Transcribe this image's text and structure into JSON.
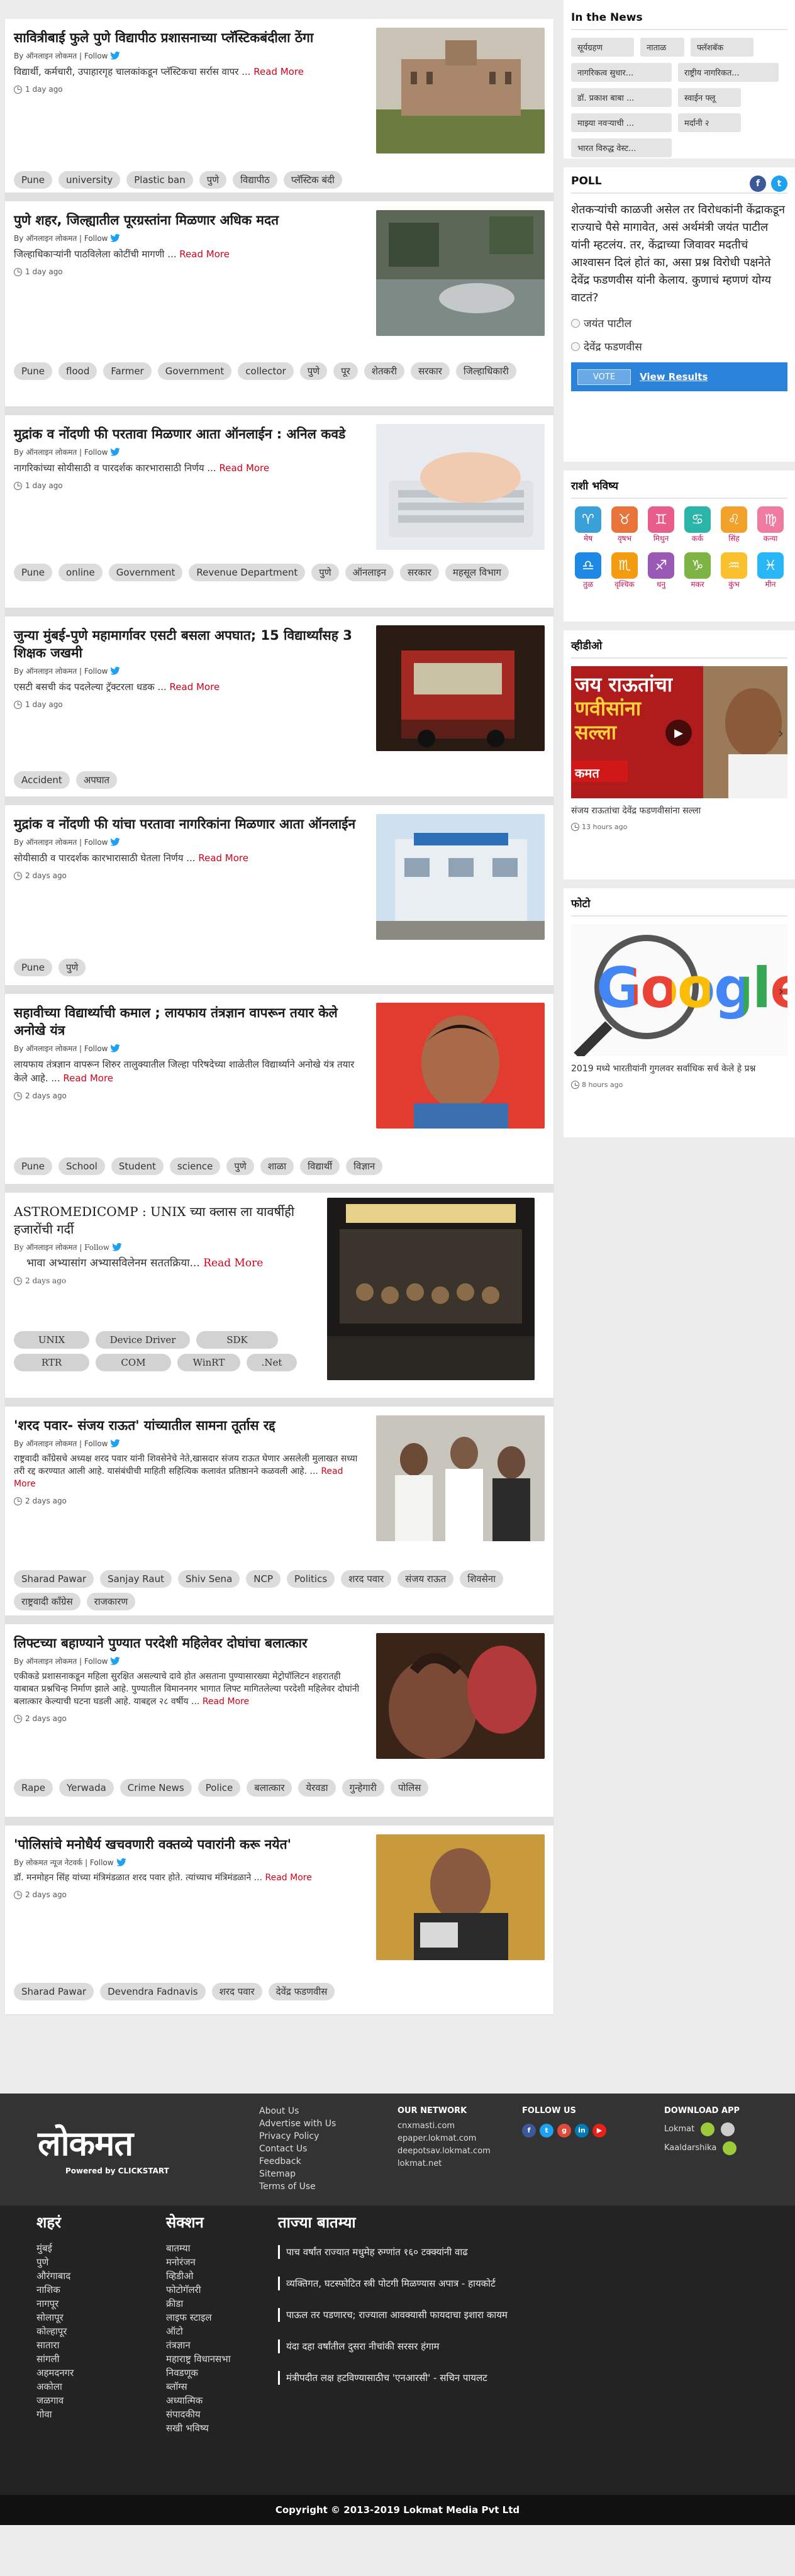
{
  "articles": [
    {
      "title": "सावित्रीबाई फुले पुणे विद्यापीठ प्रशासनाच्या प्लॅस्टिकबंदीला ठेंगा",
      "byline": "By ऑनलाइन लोकमत | Follow",
      "summary": "विद्यार्थी, कर्मचारी, उपाहारगृह चालकांकडून प्लॅस्टिकचा सर्रास वापर ...",
      "readmore": "Read More",
      "time": "1 day ago",
      "tags": [
        "Pune",
        "university",
        "Plastic ban",
        "पुणे",
        "विद्यापीठ",
        "प्लॅस्टिक बंदी"
      ]
    },
    {
      "title": "पुणे शहर, जिल्ह्यातील पूरग्रस्तांना मिळणार अधिक मदत",
      "byline": "By ऑनलाइन लोकमत | Follow",
      "summary": "जिल्हाधिकाऱ्यांनी पाठविलेला कोटींची मागणी ...",
      "readmore": "Read More",
      "time": "1 day ago",
      "tags": [
        "Pune",
        "flood",
        "Farmer",
        "Government",
        "collector",
        "पुणे",
        "पूर",
        "शेतकरी",
        "सरकार",
        "जिल्हाधिकारी"
      ]
    },
    {
      "title": "मुद्रांक व नोंदणी फी परतावा मिळणार आता ऑनलाईन : अनिल कवडे",
      "byline": "By ऑनलाइन लोकमत | Follow",
      "summary": "नागरिकांच्या सोयीसाठी व पारदर्शक कारभारासाठी निर्णय ...",
      "readmore": "Read More",
      "time": "1 day ago",
      "tags": [
        "Pune",
        "online",
        "Government",
        "Revenue Department",
        "पुणे",
        "ऑनलाइन",
        "सरकार",
        "महसूल विभाग"
      ]
    },
    {
      "title": "जुन्या मुंबई-पुणे महामार्गावर एसटी बसला अपघात; 15 विद्यार्थ्यांसह 3 शिक्षक जखमी",
      "byline": "By ऑनलाइन लोकमत | Follow",
      "summary": "एसटी बसची कंद पदलेल्या ट्रॅक्टरला धडक ...",
      "readmore": "Read More",
      "time": "1 day ago",
      "tags": [
        "Accident",
        "अपघात"
      ]
    },
    {
      "title": "मुद्रांक व नोंदणी फी यांचा परतावा नागरिकांना मिळणार आता ऑनलाईन",
      "byline": "By ऑनलाइन लोकमत | Follow",
      "summary": "सोयीसाठी व पारदर्शक कारभारासाठी घेतला निर्णय ...",
      "readmore": "Read More",
      "time": "2 days ago",
      "tags": [
        "Pune",
        "पुणे"
      ]
    },
    {
      "title": "सहावीच्या विद्यार्थ्याची कमाल ; लायफाय तंत्रज्ञान वापरून तयार केले अनोखे यंत्र",
      "byline": "By ऑनलाइन लोकमत | Follow",
      "summary": "लायफाय तंत्रज्ञान वापरून शिरुर तालुक्यातील जिल्हा परिषदेच्या शाळेतील विद्यार्थ्याने अनोखे यंत्र तयार केले आहे. ...",
      "readmore": "Read More",
      "time": "2 days ago",
      "tags": [
        "Pune",
        "School",
        "Student",
        "science",
        "पुणे",
        "शाळा",
        "विद्यार्थी",
        "विज्ञान"
      ]
    },
    {
      "title": "ASTROMEDICOMP : UNIX च्या क्लास ला यावर्षीही हजारोंची गर्दी",
      "byline": "By ऑनलाइन लोकमत | Follow",
      "summary": "भावा अभ्यासांग अभ्यासविलेनम सततक्रिया... ",
      "readmore": "Read More",
      "time": "2 days ago",
      "tags": [
        "UNIX",
        "Device Driver",
        "SDK",
        "RTR",
        "COM",
        "WinRT",
        ".Net"
      ]
    },
    {
      "title": "'शरद पवार- संजय राऊत' यांच्यातील सामना तूर्तास रद्द",
      "byline": "By ऑनलाइन लोकमत | Follow",
      "summary": "राष्ट्रवादी काँग्रेसचे अध्यक्ष शरद पवार यांनी शिवसेनेचे नेते,खासदार संजय राऊत घेणार असलेली मुलाखत सध्या तरी रद्द करण्यात आली आहे. यासंबंधीची माहिती सहित्यिक कलावंत प्रतिष्ठानने कळवली आहे. ...",
      "readmore": "Read More",
      "time": "2 days ago",
      "tags": [
        "Sharad Pawar",
        "Sanjay Raut",
        "Shiv Sena",
        "NCP",
        "Politics",
        "शरद पवार",
        "संजय राऊत",
        "शिवसेना",
        "राष्ट्रवादी काँग्रेस",
        "राजकारण"
      ]
    },
    {
      "title": "लिफ्टच्या बहाण्याने पुण्यात परदेशी महिलेवर दोघांचा बलात्कार",
      "byline": "By ऑनलाइन लोकमत | Follow",
      "summary": "एकीकडे प्रशासनाकडून महिला सुरक्षित असल्याचे दावे होत असताना पुण्यासारख्या मेट्रोपॉलिटन शहरातही याबाबत प्रश्नचिन्ह निर्माण झाले आहे. पुण्यातील विमाननगर भागात लिफ्ट मागितलेल्या परदेशी महिलेवर दोघांनी बलात्कार केल्याची घटना घडली आहे. याबद्दल २८ वर्षीय ...",
      "readmore": "Read More",
      "time": "2 days ago",
      "tags": [
        "Rape",
        "Yerwada",
        "Crime News",
        "Police",
        "बलात्कार",
        "येरवडा",
        "गुन्हेगारी",
        "पोलिस"
      ]
    },
    {
      "title": "'पोलिसांचे मनोधैर्य खचवणारी वक्तव्ये पवारांनी करू नयेत'",
      "byline": "By लोकमत न्यूज नेटवर्क | Follow",
      "summary": "डॉ. मनमोहन सिंह यांच्या मंत्रिमंडळात शरद पवार होते. त्यांच्याच मंत्रिमंडळाने ...",
      "readmore": "Read More",
      "time": "2 days ago",
      "tags": [
        "Sharad Pawar",
        "Devendra Fadnavis",
        "शरद पवार",
        "देवेंद्र फडणवीस"
      ]
    }
  ],
  "sidebar": {
    "news": {
      "title": "In the News",
      "tags": [
        "सूर्यग्रहण",
        "नाताळ",
        "फ्लॅशबॅक",
        "नागरिकत्व सुधार...",
        "राष्ट्रीय नागरिकत...",
        "डॉ. प्रकाश बाबा ...",
        "स्वाईन फ्लू",
        "माझ्या नवऱ्याची ...",
        "मर्दानी २",
        "भारत विरुद्ध वेस्ट..."
      ]
    },
    "poll": {
      "title": "POLL",
      "question": "शेतकऱ्यांची काळजी असेल तर विरोधकांनी केंद्राकडून राज्याचे पैसे मागावेत, असं अर्थमंत्री जयंत पाटील यांनी म्हटलंय. तर, केंद्राच्या जिवावर मदतीचं आश्वासन दिलं होतं का, असा प्रश्न विरोधी पक्षनेते देवेंद्र फडणवीस यांनी केलाय. कुणाचं म्हणणं योग्य वाटतं?",
      "options": [
        "जयंत पाटील",
        "देवेंद्र फडणवीस"
      ],
      "vote": "VOTE",
      "view_results": "View Results"
    },
    "rashi": {
      "title": "राशी भविष्य",
      "signs": [
        "मेष",
        "वृषभ",
        "मिथुन",
        "कर्क",
        "सिंह",
        "कन्या",
        "तुळ",
        "वृश्चिक",
        "धनु",
        "मकर",
        "कुंभ",
        "मीन"
      ],
      "glyphs": [
        "♈",
        "♉",
        "♊",
        "♋",
        "♌",
        "♍",
        "♎",
        "♏",
        "♐",
        "♑",
        "♒",
        "♓"
      ],
      "colors": [
        "#3aa0d8",
        "#e8743b",
        "#e85d8a",
        "#2bb5a8",
        "#f2a12b",
        "#ef7b9e",
        "#1e88e5",
        "#f39c12",
        "#9b59b6",
        "#7cb342",
        "#fbc02d",
        "#29b6f6"
      ]
    },
    "video": {
      "title": "व्हीडीओ",
      "overlay1": "जय राऊतांचा",
      "overlay2": "णवीसांना",
      "overlay3": "सल्ला",
      "tag": "कमत",
      "caption": "संजय राऊतांचा देवेंद्र फडणवीसांना सल्ला",
      "time": "13 hours ago"
    },
    "photo": {
      "title": "फोटो",
      "logo": "Google",
      "caption": "2019 मध्ये भारतीयांनी गुगलवर सर्वाधिक सर्च केले हे प्रश्न",
      "time": "8 hours ago"
    }
  },
  "footer": {
    "logo": "लोकमत",
    "powered": "Powered by CLICKSTART",
    "links": [
      "About Us",
      "Advertise with Us",
      "Privacy Policy",
      "Contact Us",
      "Feedback",
      "Sitemap",
      "Terms of Use"
    ],
    "network_title": "OUR NETWORK",
    "network": [
      "cnxmasti.com",
      "epaper.lokmat.com",
      "deepotsav.lokmat.com",
      "lokmat.net"
    ],
    "follow_title": "FOLLOW US",
    "download_title": "DOWNLOAD APP",
    "apps": [
      "Lokmat",
      "Kaaldarshika"
    ],
    "cities_title": "शहरं",
    "cities": [
      "मुंबई",
      "पुणे",
      "औरंगाबाद",
      "नाशिक",
      "नागपूर",
      "सोलापूर",
      "कोल्हापूर",
      "सातारा",
      "सांगली",
      "अहमदनगर",
      "अकोला",
      "जळगाव",
      "गोवा"
    ],
    "sections_title": "सेक्शन",
    "sections": [
      "बातम्या",
      "मनोरंजन",
      "व्हिडीओ",
      "फोटोगॅलरी",
      "क्रीडा",
      "लाइफ स्टाइल",
      "ऑटो",
      "तंत्रज्ञान",
      "महाराष्ट्र विधानसभा निवडणूक",
      "ब्लॉग्स",
      "अध्यात्मिक",
      "संपादकीय",
      "सखी भविष्य"
    ],
    "latest_title": "ताज्या बातम्या",
    "latest": [
      "पाच वर्षांत राज्यात मधुमेह रुग्णांत १६० टक्क्यांनी वाढ",
      "व्यक्तिगत, घटस्फोटित स्त्री पोटगी मिळण्यास अपात्र - हायकोर्ट",
      "पाऊल तर पडणारच; राज्याला आवक्यासी फायदाचा इशारा कायम",
      "यंदा दहा वर्षांतील दुसरा नीचांकी सरसर हंगाम",
      "मंत्रीपदीत लक्ष हटविण्यासाठीच 'एनआरसी' - सचिन पायलट"
    ],
    "copyright": "Copyright © 2013-2019 Lokmat Media Pvt Ltd"
  }
}
